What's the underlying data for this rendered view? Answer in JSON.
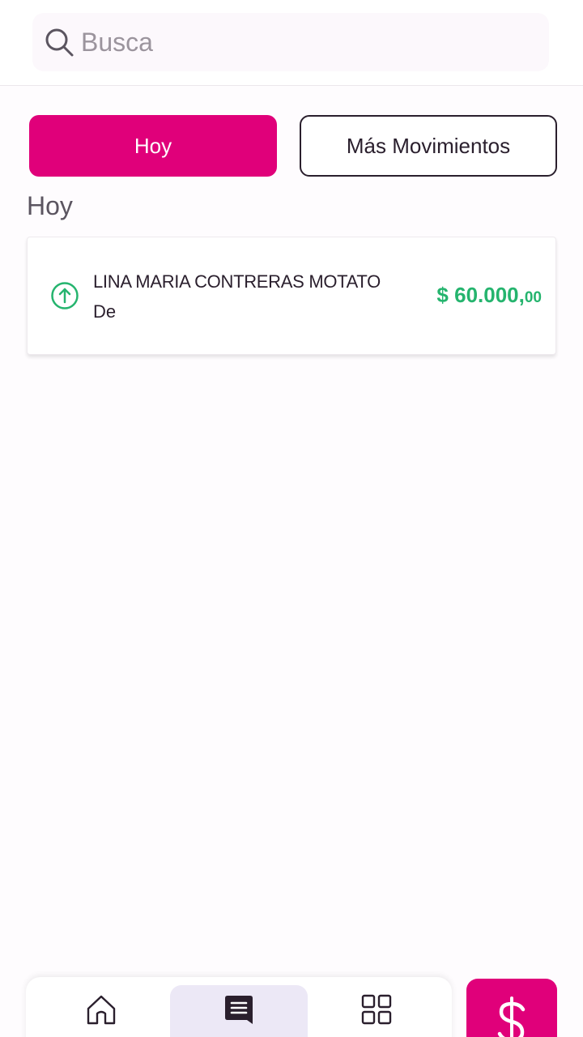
{
  "search": {
    "placeholder": "Busca",
    "icon": "search-icon"
  },
  "tabs": [
    {
      "label": "Hoy",
      "active": true
    },
    {
      "label": "Más Movimientos",
      "active": false
    }
  ],
  "section": {
    "title": "Hoy"
  },
  "transactions": [
    {
      "name": "LINA MARIA CONTRERAS MOTATO",
      "subtitle": "De",
      "amount_main": "$ 60.000,",
      "amount_cents": "00",
      "direction_icon": "arrow-up-circle-icon",
      "amount_color": "#25b46e"
    }
  ],
  "bottom_nav": {
    "items": [
      {
        "id": "home",
        "icon": "home-icon"
      },
      {
        "id": "movements",
        "icon": "movements-icon",
        "active": true
      },
      {
        "id": "apps",
        "icon": "grid-icon"
      }
    ],
    "action_icon": "dollar-icon"
  },
  "colors": {
    "accent": "#e0007a",
    "positive": "#25b46e",
    "text": "#2a1f2d",
    "nav_active_bg": "#ece8f6"
  }
}
